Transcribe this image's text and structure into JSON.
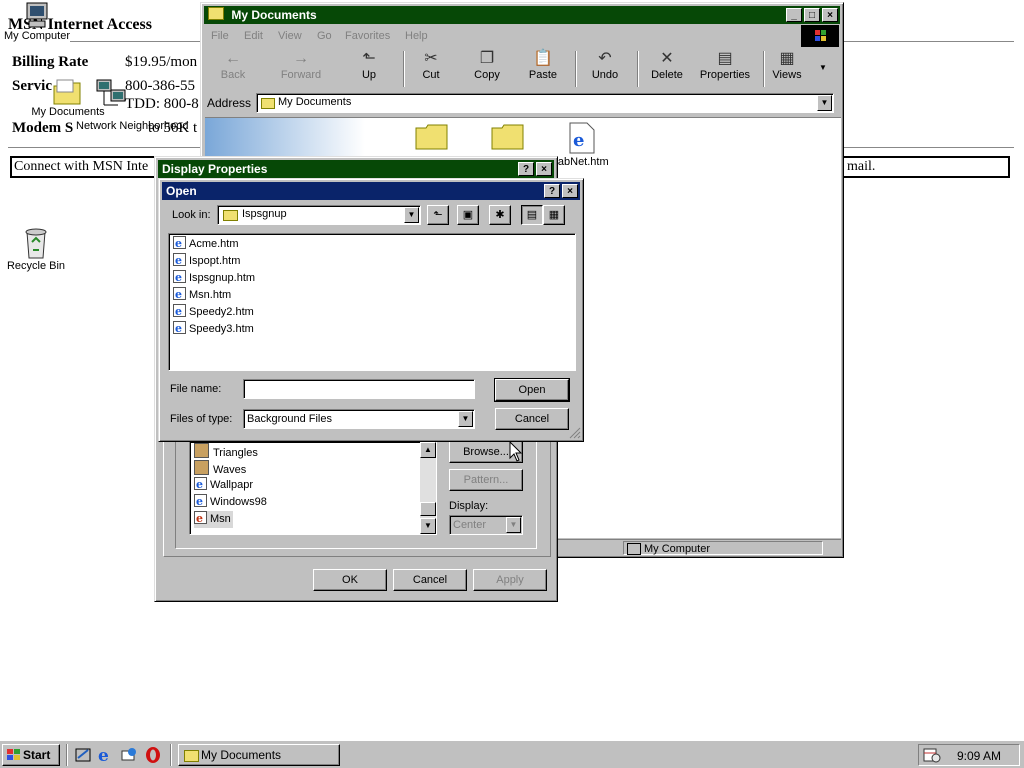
{
  "web": {
    "title": "MSN Internet Access",
    "billing_label": "Billing Rate",
    "billing_value": "$19.95/mon",
    "service_label": "Servic",
    "service_phone": "800-386-55",
    "service_tdd": "TDD: 800-8",
    "modem_label": "Modem S",
    "modem_value": "to 56K t",
    "connect_text": "Connect with MSN Inte",
    "connect_tail": "mail."
  },
  "desktop_icons": [
    {
      "label": "My Computer"
    },
    {
      "label": "My Documents"
    },
    {
      "label": "Network Neighborhood"
    },
    {
      "label": "Recycle Bin"
    }
  ],
  "mydocs": {
    "title": "My Documents",
    "menu": [
      "File",
      "Edit",
      "View",
      "Go",
      "Favorites",
      "Help"
    ],
    "toolbar": [
      "Back",
      "Forward",
      "Up",
      "Cut",
      "Copy",
      "Paste",
      "Undo",
      "Delete",
      "Properties",
      "Views"
    ],
    "address_label": "Address",
    "address_value": "My Documents",
    "file_label": "llabNet.htm",
    "status_text": "My Computer"
  },
  "display_props": {
    "title": "Display Properties",
    "list": [
      "Triangles",
      "Waves",
      "Wallpapr",
      "Windows98",
      "Msn"
    ],
    "browse": "Browse...",
    "pattern": "Pattern...",
    "display_label": "Display:",
    "display_value": "Center",
    "ok": "OK",
    "cancel": "Cancel",
    "apply": "Apply"
  },
  "open_dialog": {
    "title": "Open",
    "look_in_label": "Look in:",
    "look_in_value": "Ispsgnup",
    "files": [
      "Acme.htm",
      "Ispopt.htm",
      "Ispsgnup.htm",
      "Msn.htm",
      "Speedy2.htm",
      "Speedy3.htm"
    ],
    "file_name_label": "File name:",
    "file_name_value": "",
    "files_type_label": "Files of type:",
    "files_type_value": "Background Files",
    "open_button": "Open",
    "cancel_button": "Cancel"
  },
  "taskbar": {
    "start": "Start",
    "task": "My Documents",
    "clock": "9:09 AM"
  },
  "colors": {
    "title_active": "#0a246a",
    "title_inactive": "#064806",
    "face": "#c0c0c0"
  }
}
